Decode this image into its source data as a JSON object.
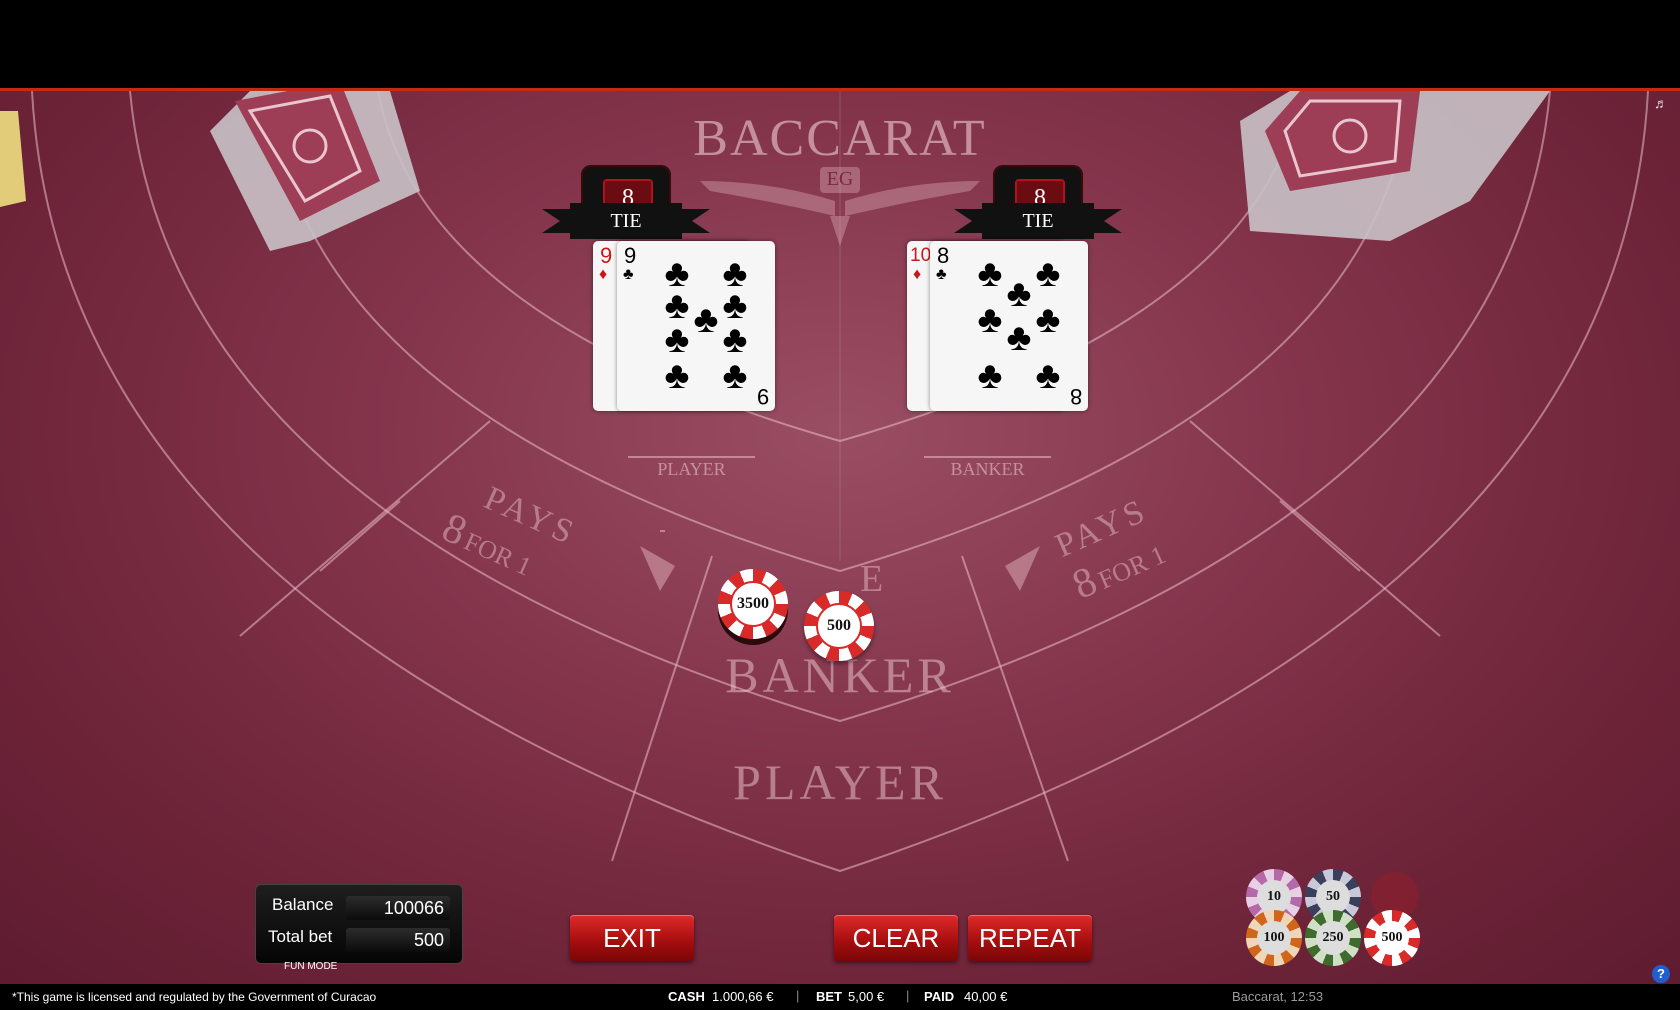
{
  "game": {
    "title": "BACCARAT",
    "logo_monogram": "EG"
  },
  "table": {
    "pays_left_line1": "PAYS",
    "pays_left_line2_num": "8",
    "pays_left_line2_rest": "FOR 1",
    "pays_right_line1": "PAYS",
    "pays_right_line2_num": "8",
    "pays_right_line2_rest": "FOR 1",
    "zone_banker": "BANKER",
    "zone_player": "PLAYER",
    "tie_zone_visible_letter": "E"
  },
  "hands": {
    "player": {
      "label": "PLAYER",
      "score": "8",
      "result": "TIE",
      "cards": [
        {
          "rank": "9",
          "suit": "♦",
          "color": "#d0151a"
        },
        {
          "rank": "9",
          "suit": "♣",
          "color": "#000000"
        }
      ]
    },
    "banker": {
      "label": "BANKER",
      "score": "8",
      "result": "TIE",
      "cards": [
        {
          "rank": "10",
          "suit": "♦",
          "color": "#d0151a"
        },
        {
          "rank": "8",
          "suit": "♣",
          "color": "#000000"
        }
      ]
    }
  },
  "bets": {
    "chip_stack_1": "3500",
    "chip_stack_2": "500"
  },
  "account": {
    "balance_label": "Balance",
    "balance_value": "100066",
    "total_bet_label": "Total bet",
    "total_bet_value": "500",
    "mode": "FUN MODE"
  },
  "buttons": {
    "exit": "EXIT",
    "clear": "CLEAR",
    "repeat": "REPEAT"
  },
  "chip_rack": [
    {
      "value": "10",
      "color": "#b46aa8"
    },
    {
      "value": "50",
      "color": "#3a3f5c"
    },
    {
      "value": "100",
      "color": "#d0661c"
    },
    {
      "value": "250",
      "color": "#3f6b2e"
    },
    {
      "value": "500",
      "color": "#d92a2a"
    }
  ],
  "footer": {
    "license": "*This game is licensed and regulated by the Government of Curacao",
    "cash_label": "CASH",
    "cash_value": "1.000,66 €",
    "bet_label": "BET",
    "bet_value": "5,00 €",
    "paid_label": "PAID",
    "paid_value": "40,00 €",
    "separator": "|",
    "game_time": "Baccarat, 12:53"
  },
  "colors": {
    "felt": "#84354c",
    "accent_red": "#c42a1a",
    "button_red": "#b01010"
  },
  "icons": {
    "sound": "speaker-icon",
    "help": "help-icon",
    "undo": "undo-icon"
  }
}
